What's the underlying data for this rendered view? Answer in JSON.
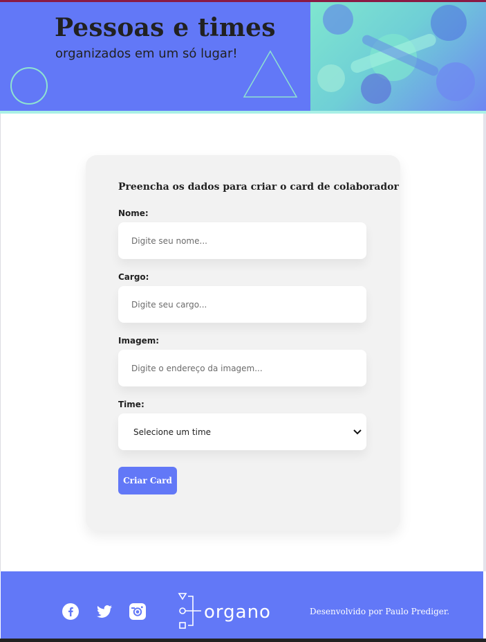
{
  "banner": {
    "title": "Pessoas e times",
    "subtitle": "organizados em um só lugar!",
    "photo_icon": "team-hands-photo"
  },
  "form": {
    "heading": "Preencha os dados para criar o card de colaborador",
    "fields": [
      {
        "label": "Nome:",
        "placeholder": "Digite seu nome..."
      },
      {
        "label": "Cargo:",
        "placeholder": "Digite seu cargo..."
      },
      {
        "label": "Imagem:",
        "placeholder": "Digite o endereço da imagem..."
      }
    ],
    "select": {
      "label": "Time:",
      "selected": "Selecione um time"
    },
    "submit_label": "Criar Card"
  },
  "footer": {
    "social_icons": [
      "facebook-icon",
      "twitter-icon",
      "instagram-icon"
    ],
    "logo_text": "organo",
    "credit": "Desenvolvido por Paulo Prediger."
  },
  "colors": {
    "primary": "#6278f7",
    "accent": "#8fe3d1",
    "card_bg": "#f2f2f2",
    "text": "#212121"
  }
}
